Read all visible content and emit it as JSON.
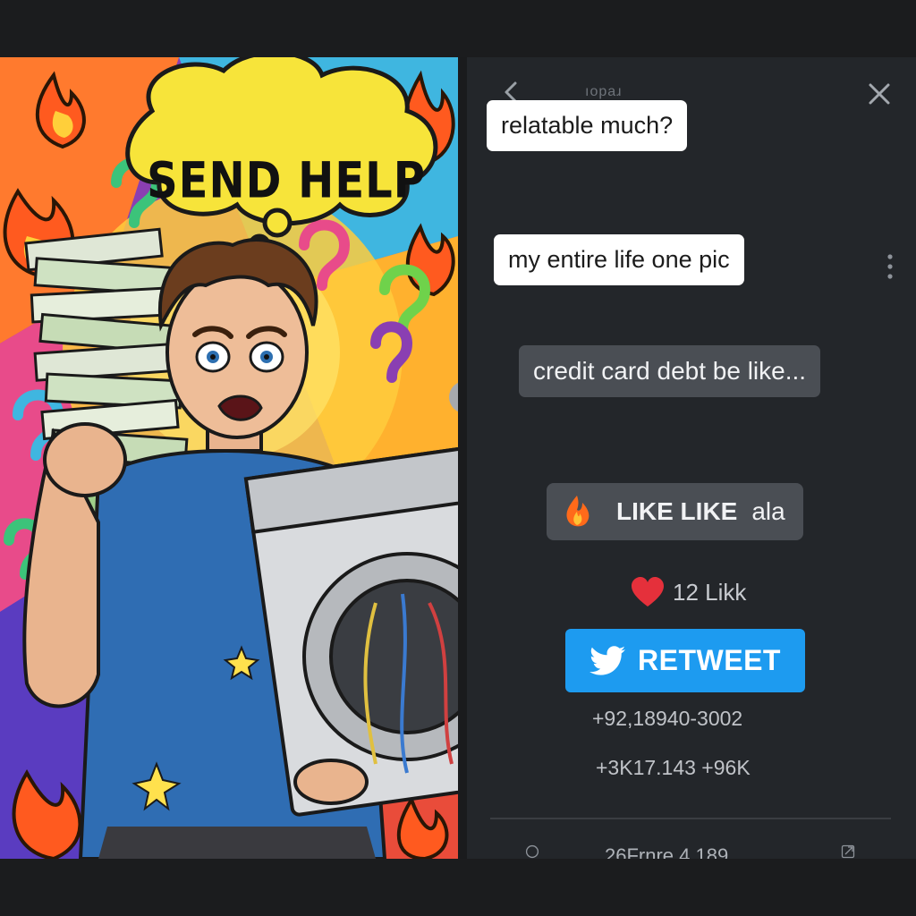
{
  "meme": {
    "bubble_text": "SEND HELP"
  },
  "panel": {
    "faded_handle": "ıopaɹ",
    "chips": [
      {
        "text": "relatable much?"
      },
      {
        "text": "my entire life one pic"
      },
      {
        "text": "credit card debt be like..."
      }
    ],
    "like_pill": {
      "strong": "LIKE LIKE",
      "trail": "ala"
    },
    "heart_count": "12 Likk",
    "retweet_label": "RETWEET",
    "stat_1": "+92,18940-3002",
    "stat_2": "+3K17.143 +96K",
    "footer_text": "26Frnre 4 189"
  },
  "colors": {
    "panel_bg": "#23262a",
    "retweet_blue": "#1d9bf0",
    "heart_red": "#e5303b",
    "bubble_yellow": "#f7e43a"
  },
  "icons": [
    "back-icon",
    "close-icon",
    "kebab-icon",
    "fire-icon",
    "heart-icon",
    "twitter-bird-icon",
    "comment-icon",
    "share-icon"
  ]
}
